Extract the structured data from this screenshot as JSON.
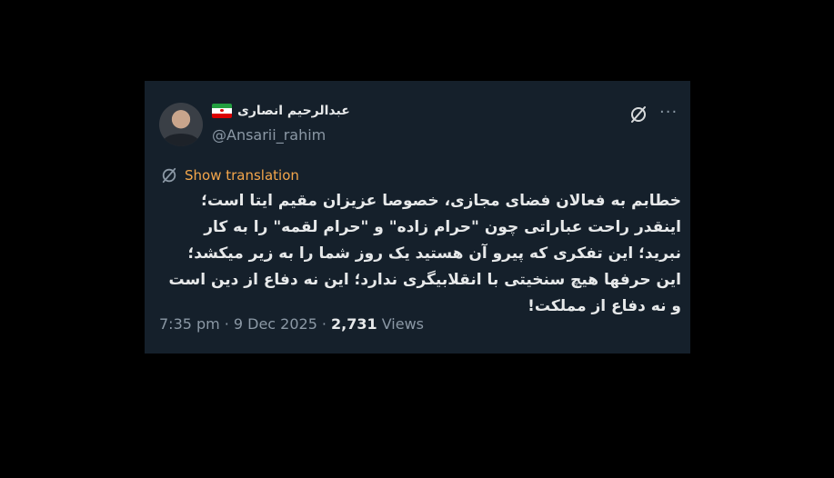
{
  "tweet": {
    "author": {
      "display_name": "عبدالرحیم انصاری",
      "handle": "@Ansarii_rahim",
      "flag_icon": "iran-flag-icon"
    },
    "show_translation_label": "Show translation",
    "text": "خطابم به فعالان فضای مجازی، خصوصا عزیزان مقیم ایتا است؛ اینقدر راحت عباراتی چون \"حرام زاده\" و \"حرام لقمه\" را به کار نبرید؛ این تفکری که پیرو آن هستید یک روز شما را به زیر میکشد؛ این حرفها هیچ سنخیتی با انقلابیگری ندارد؛ این نه دفاع از دین است و نه دفاع از مملکت!",
    "time": "7:35 pm",
    "separator": "·",
    "date": "9 Dec 2025",
    "views_count": "2,731",
    "views_label": "Views"
  },
  "colors": {
    "background": "#000000",
    "card": "#15202b",
    "primary_text": "#e7e9ea",
    "secondary_text": "#8b98a5",
    "translation_accent": "#f4a64b"
  }
}
